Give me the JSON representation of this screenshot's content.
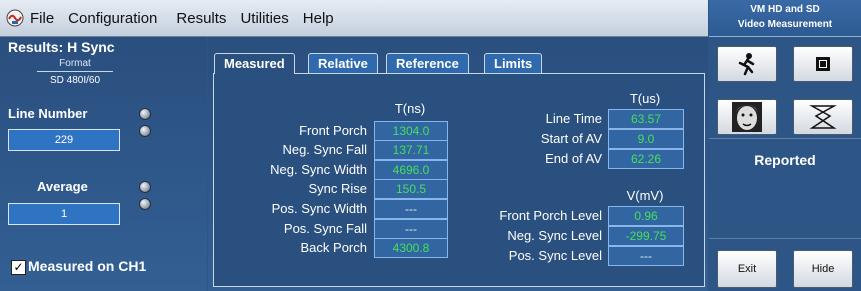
{
  "menu": {
    "items": [
      "File",
      "Configuration",
      "Results",
      "Utilities",
      "Help"
    ]
  },
  "left": {
    "title": "Results: H Sync",
    "format_label": "Format",
    "format_value": "SD 480I/60",
    "line_number_label": "Line Number",
    "line_number_value": "229",
    "average_label": "Average",
    "average_value": "1",
    "measured_on_label": "Measured on CH1",
    "measured_on_checked": true
  },
  "tabs": [
    "Measured",
    "Relative",
    "Reference",
    "Limits"
  ],
  "measured": {
    "t_ns_header": "T(ns)",
    "t_us_header": "T(us)",
    "v_mv_header": "V(mV)",
    "left_rows": [
      {
        "label": "Front Porch",
        "value": "1304.0"
      },
      {
        "label": "Neg. Sync Fall",
        "value": "137.71"
      },
      {
        "label": "Neg. Sync Width",
        "value": "4696.0"
      },
      {
        "label": "Sync Rise",
        "value": "150.5"
      },
      {
        "label": "Pos. Sync Width",
        "value": "---"
      },
      {
        "label": "Pos. Sync Fall",
        "value": "---"
      },
      {
        "label": "Back Porch",
        "value": "4300.8"
      }
    ],
    "right_time_rows": [
      {
        "label": "Line Time",
        "value": "63.57"
      },
      {
        "label": "Start of AV",
        "value": "9.0"
      },
      {
        "label": "End of AV",
        "value": "62.26"
      }
    ],
    "right_volt_rows": [
      {
        "label": "Front Porch Level",
        "value": "0.96"
      },
      {
        "label": "Neg. Sync Level",
        "value": "-299.75"
      },
      {
        "label": "Pos. Sync Level",
        "value": "---"
      }
    ]
  },
  "right": {
    "title_line1": "VM HD and SD",
    "title_line2": "Video Measurement",
    "reported_label": "Reported",
    "exit_label": "Exit",
    "hide_label": "Hide",
    "icons": [
      "run-icon",
      "stop-icon",
      "face-icon",
      "waveform-icon"
    ]
  },
  "colors": {
    "panel_bg": "#2d5586",
    "value_green": "#45e05a",
    "value_box": "#3266a2",
    "menubar": "#d4dce8"
  }
}
